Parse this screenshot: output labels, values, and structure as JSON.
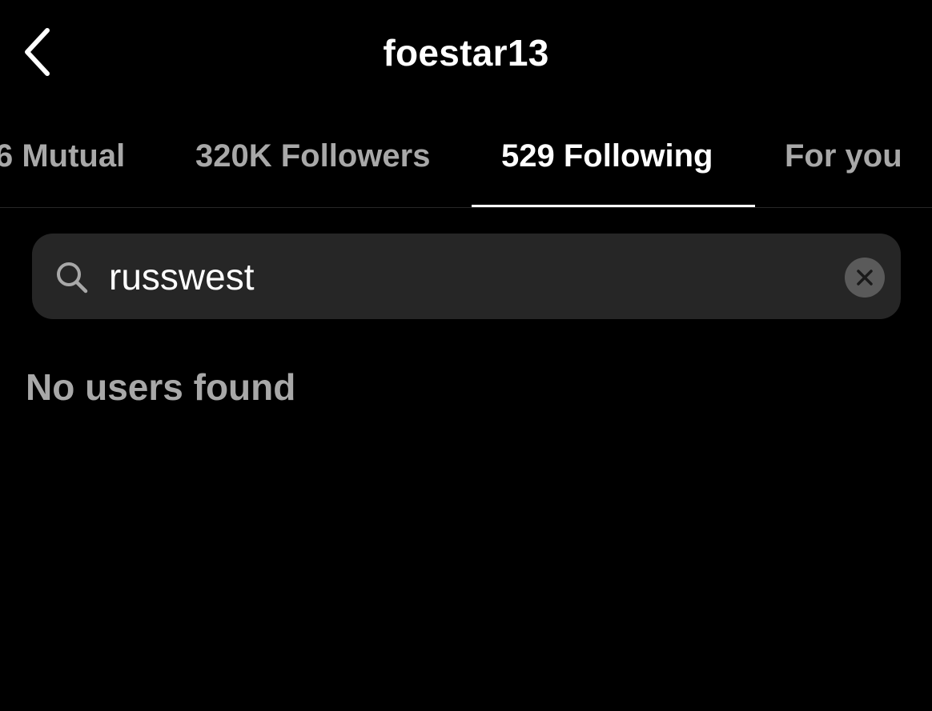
{
  "header": {
    "title": "foestar13",
    "back_icon": "chevron-left-icon"
  },
  "tabs": [
    {
      "label": "6 Mutual",
      "active": false
    },
    {
      "label": "320K Followers",
      "active": false
    },
    {
      "label": "529 Following",
      "active": true
    },
    {
      "label": "For you",
      "active": false
    }
  ],
  "search": {
    "icon": "search-icon",
    "value": "russwest",
    "clear_icon": "clear-icon"
  },
  "results": {
    "empty_message": "No users found"
  },
  "colors": {
    "background": "#000000",
    "text_primary": "#ffffff",
    "text_secondary": "#a8a8a8",
    "search_background": "#262626",
    "clear_button": "#5a5a5a",
    "active_indicator": "#ffffff"
  }
}
